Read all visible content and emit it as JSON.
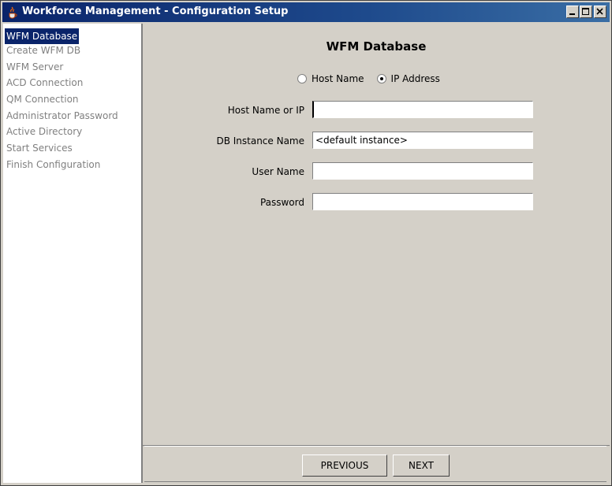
{
  "window": {
    "title": "Workforce Management - Configuration Setup",
    "icon": "java-cup-icon"
  },
  "sidebar": {
    "items": [
      {
        "label": "WFM Database",
        "active": true
      },
      {
        "label": "Create WFM DB",
        "active": false
      },
      {
        "label": "WFM Server",
        "active": false
      },
      {
        "label": "ACD Connection",
        "active": false
      },
      {
        "label": "QM Connection",
        "active": false
      },
      {
        "label": "Administrator Password",
        "active": false
      },
      {
        "label": "Active Directory",
        "active": false
      },
      {
        "label": "Start Services",
        "active": false
      },
      {
        "label": "Finish Configuration",
        "active": false
      }
    ]
  },
  "main": {
    "heading": "WFM Database",
    "radios": [
      {
        "label": "Host Name",
        "checked": false
      },
      {
        "label": "IP Address",
        "checked": true
      }
    ],
    "fields": [
      {
        "label": "Host Name or IP",
        "value": ""
      },
      {
        "label": "DB Instance Name",
        "value": "<default instance>"
      },
      {
        "label": "User Name",
        "value": ""
      },
      {
        "label": "Password",
        "value": ""
      }
    ]
  },
  "footer": {
    "previous_label": "PREVIOUS",
    "next_label": "NEXT"
  },
  "colors": {
    "titlebar": "#0a246a",
    "selection": "#0a246a",
    "panel": "#d4d0c8"
  }
}
